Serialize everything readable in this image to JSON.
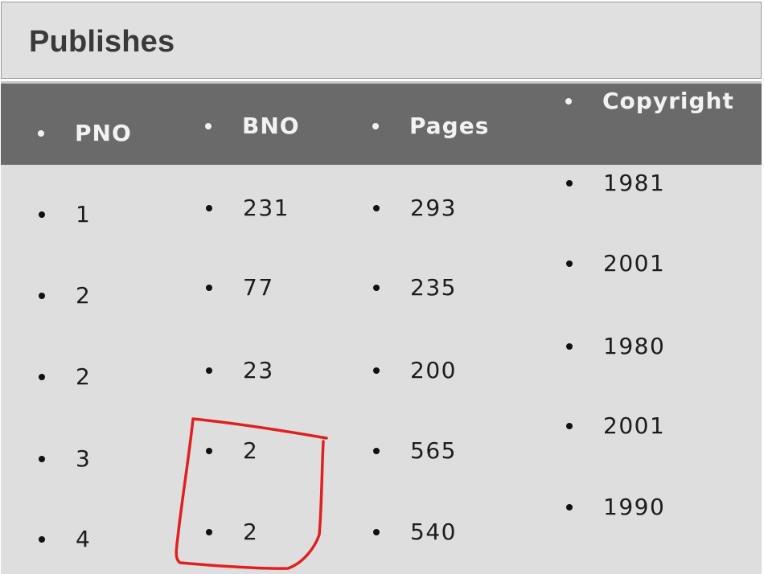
{
  "title": "Publishes",
  "table": {
    "headers": [
      "PNO",
      "BNO",
      "Pages",
      "Copyright"
    ],
    "rows": [
      [
        "1",
        "231",
        "293",
        "1981"
      ],
      [
        "2",
        "77",
        "235",
        "2001"
      ],
      [
        "2",
        "23",
        "200",
        "1980"
      ],
      [
        "3",
        "2",
        "565",
        "2001"
      ],
      [
        "4",
        "2",
        "540",
        "1990"
      ]
    ]
  },
  "annotation": {
    "color": "#e02020",
    "shape": "hand-drawn box around BNO values 2 and 2"
  }
}
